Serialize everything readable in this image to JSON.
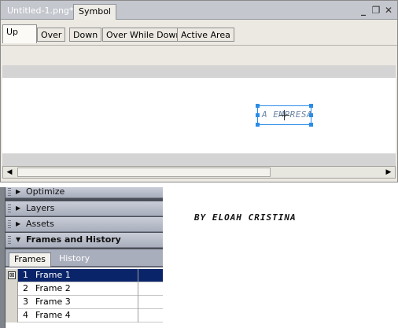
{
  "editor": {
    "doc_tab": "Untitled-1.png*",
    "symbol_tab": "Symbol",
    "state_tabs": [
      "Up",
      "Over",
      "Down",
      "Over While Down",
      "Active Area"
    ],
    "selected_state": "Up",
    "symbol_text": "A EMPRESA"
  },
  "panel": {
    "groups": [
      {
        "label": "Optimize",
        "open": false
      },
      {
        "label": "Layers",
        "open": false
      },
      {
        "label": "Assets",
        "open": false
      },
      {
        "label": "Frames and History",
        "open": true
      }
    ],
    "subtabs": [
      "Frames",
      "History"
    ],
    "frames": [
      {
        "num": "1",
        "name": "Frame 1",
        "selected": true
      },
      {
        "num": "2",
        "name": "Frame 2",
        "selected": false
      },
      {
        "num": "3",
        "name": "Frame 3",
        "selected": false
      },
      {
        "num": "4",
        "name": "Frame 4",
        "selected": false
      }
    ]
  },
  "signature": "BY ELOAH CRISTINA",
  "colors": {
    "selection": "#0a246a",
    "handle": "#2b8ce8",
    "panel_header": "#a9aebc"
  }
}
